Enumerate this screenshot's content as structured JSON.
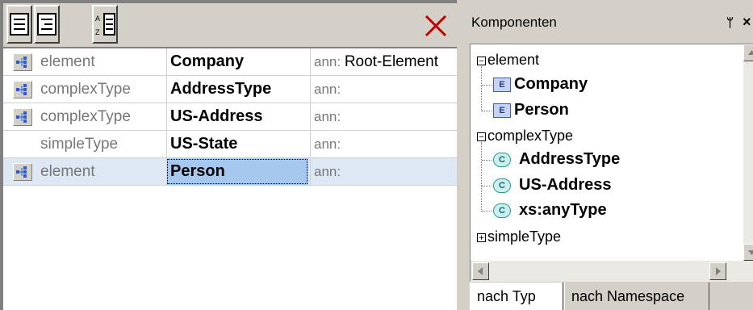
{
  "toolbar": {
    "buttons": [
      "view-list-icon",
      "view-tree-icon",
      "sort-az-icon"
    ],
    "close_icon": "red-x-icon"
  },
  "rows": [
    {
      "kind": "element",
      "name": "Company",
      "ann_label": "ann:",
      "ann_value": "Root-Element",
      "icon": true,
      "selected": false
    },
    {
      "kind": "complexType",
      "name": "AddressType",
      "ann_label": "ann:",
      "ann_value": "",
      "icon": true,
      "selected": false
    },
    {
      "kind": "complexType",
      "name": "US-Address",
      "ann_label": "ann:",
      "ann_value": "",
      "icon": true,
      "selected": false
    },
    {
      "kind": "simpleType",
      "name": "US-State",
      "ann_label": "ann:",
      "ann_value": "",
      "icon": false,
      "selected": false
    },
    {
      "kind": "element",
      "name": "Person",
      "ann_label": "ann:",
      "ann_value": "",
      "icon": true,
      "selected": true
    }
  ],
  "panel": {
    "title": "Komponenten",
    "pin": "ᛘ",
    "close": "×",
    "tree": {
      "element_group": "element",
      "element_items": [
        "Company",
        "Person"
      ],
      "complex_group": "complexType",
      "complex_items": [
        "AddressType",
        "US-Address",
        "xs:anyType"
      ],
      "simple_group": "simpleType"
    },
    "tabs": [
      "nach Typ",
      "nach Namespace"
    ],
    "badge_e": "E",
    "badge_c": "C"
  }
}
